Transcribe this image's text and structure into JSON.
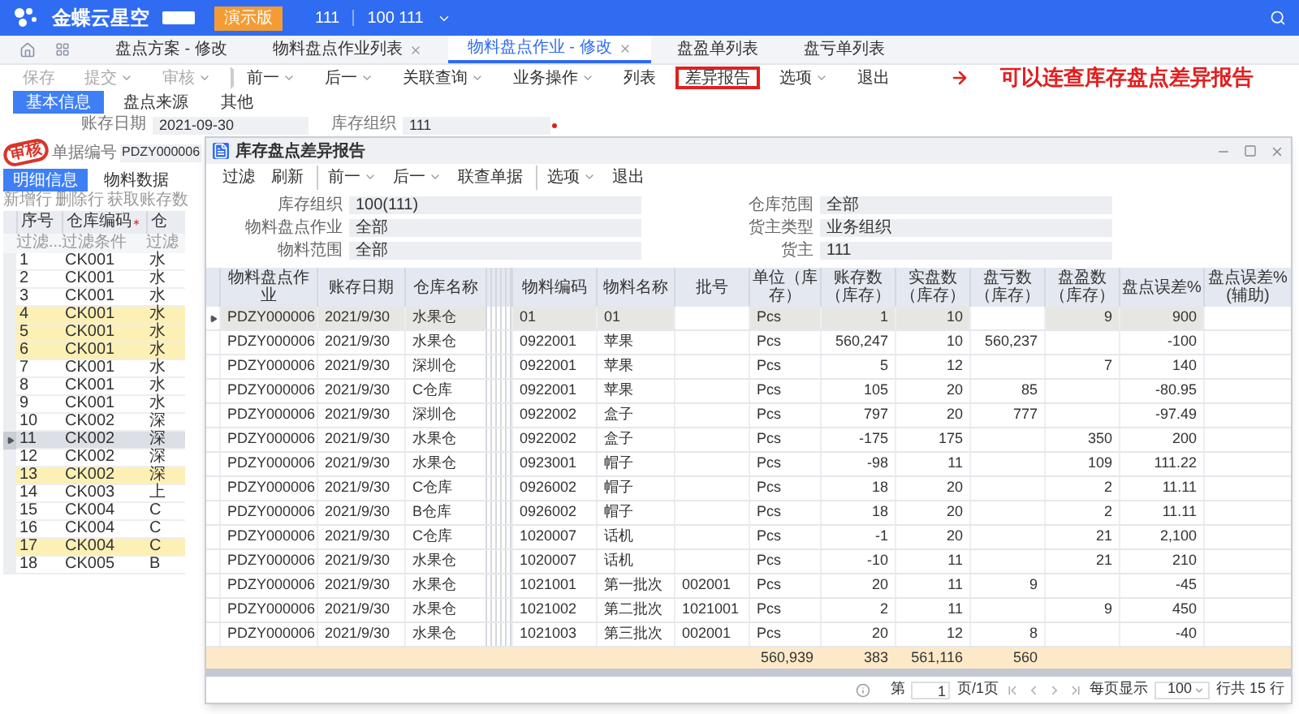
{
  "top_bar": {
    "product": "金蝶云星空",
    "demo_button": "演示版",
    "org": "111",
    "user": "100 111"
  },
  "tabs": [
    {
      "label": "盘点方案 - 修改",
      "selected": false,
      "closable": false
    },
    {
      "label": "物料盘点作业列表",
      "selected": false,
      "closable": true
    },
    {
      "label": "物料盘点作业 - 修改",
      "selected": true,
      "closable": true
    },
    {
      "label": "盘盈单列表",
      "selected": false,
      "closable": false
    },
    {
      "label": "盘亏单列表",
      "selected": false,
      "closable": false
    }
  ],
  "toolbar": [
    {
      "label": "保存",
      "disabled": true,
      "dropdown": false,
      "divider_before": false,
      "highlighted": false
    },
    {
      "label": "提交",
      "disabled": true,
      "dropdown": true,
      "divider_before": false,
      "highlighted": false
    },
    {
      "label": "审核",
      "disabled": true,
      "dropdown": true,
      "divider_before": false,
      "highlighted": false
    },
    {
      "label": "前一",
      "disabled": false,
      "dropdown": true,
      "divider_before": true,
      "highlighted": false
    },
    {
      "label": "后一",
      "disabled": false,
      "dropdown": true,
      "divider_before": false,
      "highlighted": false
    },
    {
      "label": "关联查询",
      "disabled": false,
      "dropdown": true,
      "divider_before": false,
      "highlighted": false
    },
    {
      "label": "业务操作",
      "disabled": false,
      "dropdown": true,
      "divider_before": false,
      "highlighted": false
    },
    {
      "label": "列表",
      "disabled": false,
      "dropdown": false,
      "divider_before": false,
      "highlighted": false
    },
    {
      "label": "差异报告",
      "disabled": false,
      "dropdown": false,
      "divider_before": false,
      "highlighted": true
    },
    {
      "label": "选项",
      "disabled": false,
      "dropdown": true,
      "divider_before": false,
      "highlighted": false
    },
    {
      "label": "退出",
      "disabled": false,
      "dropdown": false,
      "divider_before": false,
      "highlighted": false
    }
  ],
  "annotation": "可以连查库存盘点差异报告",
  "form_tabs": [
    {
      "label": "基本信息",
      "selected": true
    },
    {
      "label": "盘点来源",
      "selected": false
    },
    {
      "label": "其他",
      "selected": false
    }
  ],
  "fields": [
    {
      "label": "账存日期",
      "value": "2021-09-30",
      "required": false
    },
    {
      "label": "库存组织",
      "value": "111",
      "required": true
    }
  ],
  "bill_field": {
    "label": "单据编号",
    "value": "PDZY000006"
  },
  "stamp": "审核",
  "detail_tabs": [
    {
      "label": "明细信息",
      "selected": true
    },
    {
      "label": "物料数据",
      "selected": false
    }
  ],
  "detail_buttons": [
    "新增行",
    "删除行",
    "获取账存数"
  ],
  "detail_grid": {
    "columns": [
      {
        "label": "序号",
        "required": false
      },
      {
        "label": "仓库编码",
        "required": true
      },
      {
        "label": "仓",
        "required": false
      }
    ],
    "filters": [
      "过滤...",
      "过滤条件",
      "过滤"
    ],
    "rows": [
      {
        "cells": [
          "1",
          "CK001",
          "水"
        ],
        "selected": false,
        "highlighted": false
      },
      {
        "cells": [
          "2",
          "CK001",
          "水"
        ],
        "selected": false,
        "highlighted": false
      },
      {
        "cells": [
          "3",
          "CK001",
          "水"
        ],
        "selected": false,
        "highlighted": false
      },
      {
        "cells": [
          "4",
          "CK001",
          "水"
        ],
        "selected": false,
        "highlighted": true
      },
      {
        "cells": [
          "5",
          "CK001",
          "水"
        ],
        "selected": false,
        "highlighted": true
      },
      {
        "cells": [
          "6",
          "CK001",
          "水"
        ],
        "selected": false,
        "highlighted": true
      },
      {
        "cells": [
          "7",
          "CK001",
          "水"
        ],
        "selected": false,
        "highlighted": false
      },
      {
        "cells": [
          "8",
          "CK001",
          "水"
        ],
        "selected": false,
        "highlighted": false
      },
      {
        "cells": [
          "9",
          "CK001",
          "水"
        ],
        "selected": false,
        "highlighted": false
      },
      {
        "cells": [
          "10",
          "CK002",
          "深"
        ],
        "selected": false,
        "highlighted": false
      },
      {
        "cells": [
          "11",
          "CK002",
          "深"
        ],
        "selected": true,
        "highlighted": false
      },
      {
        "cells": [
          "12",
          "CK002",
          "深"
        ],
        "selected": false,
        "highlighted": false
      },
      {
        "cells": [
          "13",
          "CK002",
          "深"
        ],
        "selected": false,
        "highlighted": true
      },
      {
        "cells": [
          "14",
          "CK003",
          "上"
        ],
        "selected": false,
        "highlighted": false
      },
      {
        "cells": [
          "15",
          "CK004",
          "C"
        ],
        "selected": false,
        "highlighted": false
      },
      {
        "cells": [
          "16",
          "CK004",
          "C"
        ],
        "selected": false,
        "highlighted": false
      },
      {
        "cells": [
          "17",
          "CK004",
          "C"
        ],
        "selected": false,
        "highlighted": true
      },
      {
        "cells": [
          "18",
          "CK005",
          "B"
        ],
        "selected": false,
        "highlighted": false
      }
    ]
  },
  "dialog": {
    "title": "库存盘点差异报告",
    "toolbar": [
      {
        "label": "过滤",
        "dropdown": false,
        "divider_before": false
      },
      {
        "label": "刷新",
        "dropdown": false,
        "divider_before": false
      },
      {
        "label": "前一",
        "dropdown": true,
        "divider_before": true
      },
      {
        "label": "后一",
        "dropdown": true,
        "divider_before": false
      },
      {
        "label": "联查单据",
        "dropdown": false,
        "divider_before": false
      },
      {
        "label": "选项",
        "dropdown": true,
        "divider_before": true
      },
      {
        "label": "退出",
        "dropdown": false,
        "divider_before": false
      }
    ],
    "fields_left": [
      {
        "label": "库存组织",
        "value": "100(111)"
      },
      {
        "label": "物料盘点作业",
        "value": "全部"
      },
      {
        "label": "物料范围",
        "value": "全部"
      }
    ],
    "fields_right": [
      {
        "label": "仓库范围",
        "value": "全部"
      },
      {
        "label": "货主类型",
        "value": "业务组织"
      },
      {
        "label": "货主",
        "value": "111"
      }
    ],
    "columns": [
      "物料盘点作业",
      "账存日期",
      "仓库名称",
      "物料编码",
      "物料名称",
      "批号",
      "单位（库存）",
      "账存数（库存）",
      "实盘数（库存）",
      "盘亏数（库存）",
      "盘盈数（库存）",
      "盘点误差%",
      "盘点误差%(辅助)"
    ],
    "rows": [
      {
        "selected": true,
        "cells": [
          "PDZY000006",
          "2021/9/30",
          "水果仓",
          "01",
          "01",
          null,
          "Pcs",
          "1",
          "10",
          null,
          "9",
          "900",
          null
        ]
      },
      {
        "selected": false,
        "cells": [
          "PDZY000006",
          "2021/9/30",
          "水果仓",
          "0922001",
          "苹果",
          null,
          "Pcs",
          "560,247",
          "10",
          "560,237",
          null,
          "-100",
          null
        ]
      },
      {
        "selected": false,
        "cells": [
          "PDZY000006",
          "2021/9/30",
          "深圳仓",
          "0922001",
          "苹果",
          null,
          "Pcs",
          "5",
          "12",
          null,
          "7",
          "140",
          null
        ]
      },
      {
        "selected": false,
        "cells": [
          "PDZY000006",
          "2021/9/30",
          "C仓库",
          "0922001",
          "苹果",
          null,
          "Pcs",
          "105",
          "20",
          "85",
          null,
          "-80.95",
          null
        ]
      },
      {
        "selected": false,
        "cells": [
          "PDZY000006",
          "2021/9/30",
          "深圳仓",
          "0922002",
          "盒子",
          null,
          "Pcs",
          "797",
          "20",
          "777",
          null,
          "-97.49",
          null
        ]
      },
      {
        "selected": false,
        "cells": [
          "PDZY000006",
          "2021/9/30",
          "水果仓",
          "0922002",
          "盒子",
          null,
          "Pcs",
          "-175",
          "175",
          null,
          "350",
          "200",
          null
        ]
      },
      {
        "selected": false,
        "cells": [
          "PDZY000006",
          "2021/9/30",
          "水果仓",
          "0923001",
          "帽子",
          null,
          "Pcs",
          "-98",
          "11",
          null,
          "109",
          "111.22",
          null
        ]
      },
      {
        "selected": false,
        "cells": [
          "PDZY000006",
          "2021/9/30",
          "C仓库",
          "0926002",
          "帽子",
          null,
          "Pcs",
          "18",
          "20",
          null,
          "2",
          "11.11",
          null
        ]
      },
      {
        "selected": false,
        "cells": [
          "PDZY000006",
          "2021/9/30",
          "B仓库",
          "0926002",
          "帽子",
          null,
          "Pcs",
          "18",
          "20",
          null,
          "2",
          "11.11",
          null
        ]
      },
      {
        "selected": false,
        "cells": [
          "PDZY000006",
          "2021/9/30",
          "C仓库",
          "1020007",
          "话机",
          null,
          "Pcs",
          "-1",
          "20",
          null,
          "21",
          "2,100",
          null
        ]
      },
      {
        "selected": false,
        "cells": [
          "PDZY000006",
          "2021/9/30",
          "水果仓",
          "1020007",
          "话机",
          null,
          "Pcs",
          "-10",
          "11",
          null,
          "21",
          "210",
          null
        ]
      },
      {
        "selected": false,
        "cells": [
          "PDZY000006",
          "2021/9/30",
          "水果仓",
          "1021001",
          "第一批次",
          "002001",
          "Pcs",
          "20",
          "11",
          "9",
          null,
          "-45",
          null
        ]
      },
      {
        "selected": false,
        "cells": [
          "PDZY000006",
          "2021/9/30",
          "水果仓",
          "1021002",
          "第二批次",
          "1021001",
          "Pcs",
          "2",
          "11",
          null,
          "9",
          "450",
          null
        ]
      },
      {
        "selected": false,
        "cells": [
          "PDZY000006",
          "2021/9/30",
          "水果仓",
          "1021003",
          "第三批次",
          "002001",
          "Pcs",
          "20",
          "12",
          "8",
          null,
          "-40",
          null
        ]
      }
    ],
    "totals": [
      "560,939",
      "383",
      "561,116",
      "560"
    ],
    "pagination": {
      "page_prefix": "第",
      "page": "1",
      "page_suffix": "页/1页",
      "per_page_label": "每页显示",
      "per_page": "100",
      "total": "行共 15 行"
    }
  }
}
